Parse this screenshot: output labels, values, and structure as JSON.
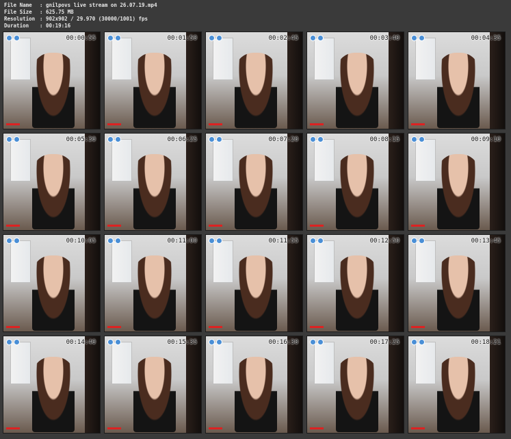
{
  "header": {
    "file_name_label": "File Name",
    "file_name": ": gnilpovs live stream on 26.07.19.mp4",
    "file_size_label": "File Size",
    "file_size": ": 625.75 MB",
    "resolution_label": "Resolution",
    "resolution": ": 902x902 / 29.970 (30000/1001) fps",
    "duration_label": "Duration",
    "duration": ": 00:19:16"
  },
  "timestamps": [
    "00:00:55",
    "00:01:50",
    "00:02:45",
    "00:03:40",
    "00:04:35",
    "00:05:30",
    "00:06:25",
    "00:07:20",
    "00:08:15",
    "00:09:10",
    "00:10:05",
    "00:11:00",
    "00:11:55",
    "00:12:50",
    "00:13:45",
    "00:14:40",
    "00:15:35",
    "00:16:30",
    "00:17:25",
    "00:18:21"
  ]
}
